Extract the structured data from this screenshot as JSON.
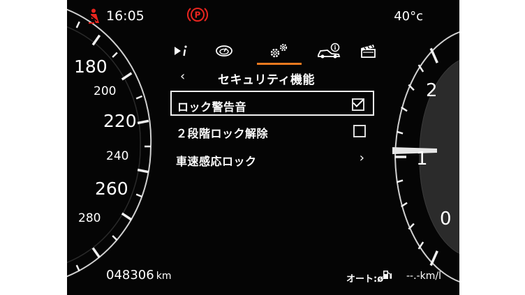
{
  "status_bar": {
    "clock": "16:05",
    "temperature": "40°c",
    "icons": {
      "seatbelt": "seatbelt-warning-icon",
      "parking_brake": "parking-brake-warning-icon"
    },
    "colors": {
      "warning": "#e8251f",
      "accent": "#e8791f"
    }
  },
  "tabs": [
    {
      "name": "tab-info",
      "icon": "play-info-icon"
    },
    {
      "name": "tab-gauges",
      "icon": "gauge-icon"
    },
    {
      "name": "tab-settings",
      "icon": "gears-icon",
      "active": true
    },
    {
      "name": "tab-vehicle-info",
      "icon": "car-info-icon"
    },
    {
      "name": "tab-media",
      "icon": "clapperboard-icon"
    }
  ],
  "menu": {
    "title": "セキュリティ機能",
    "items": [
      {
        "label": "ロック警告音",
        "control": "checkbox",
        "checked": true,
        "selected": true
      },
      {
        "label": "２段階ロック解除",
        "control": "checkbox",
        "checked": false
      },
      {
        "label": "車速感応ロック",
        "control": "chevron"
      }
    ]
  },
  "speedometer": {
    "labels": [
      "180",
      "200",
      "220",
      "240",
      "260",
      "280"
    ]
  },
  "tachometer": {
    "labels": [
      "2",
      "1",
      "0"
    ]
  },
  "footer": {
    "odometer_value": "048306",
    "odometer_unit": "km",
    "economy_label": "オート:ø",
    "economy_value": "--.-km/l"
  }
}
